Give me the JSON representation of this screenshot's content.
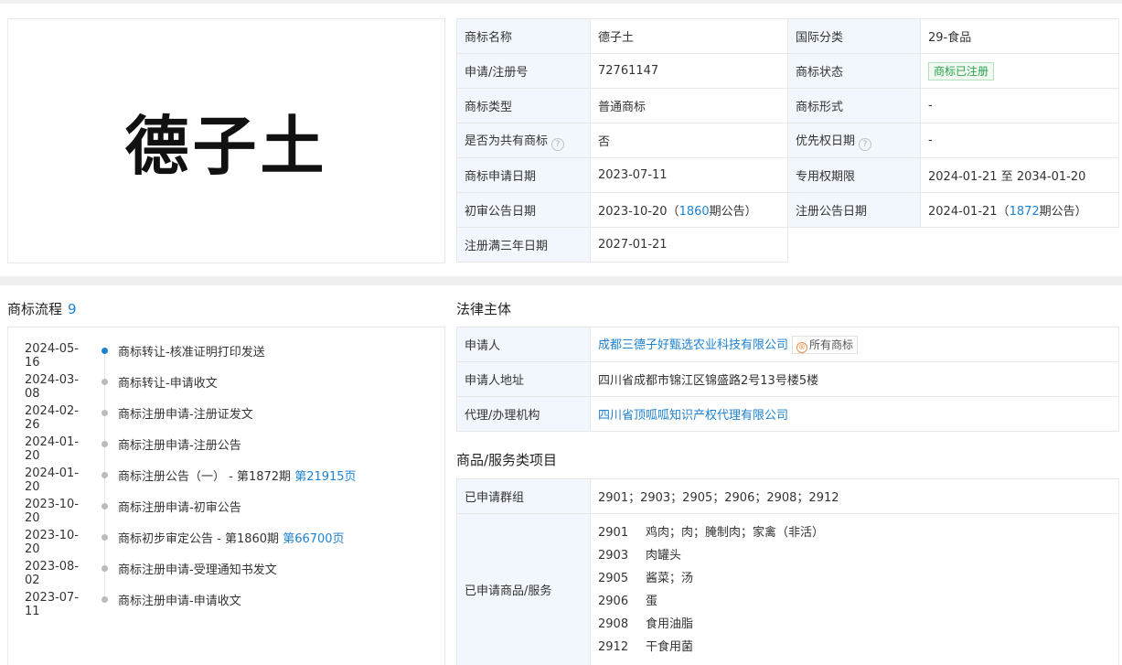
{
  "trademark": {
    "image_text": "德子土",
    "basic": [
      [
        {
          "k": "商标名称",
          "v": "德子土"
        },
        {
          "k": "国际分类",
          "v": "29-食品"
        }
      ],
      [
        {
          "k": "申请/注册号",
          "v": "72761147"
        },
        {
          "k": "商标状态",
          "v": "商标已注册"
        }
      ],
      [
        {
          "k": "商标类型",
          "v": "普通商标"
        },
        {
          "k": "商标形式",
          "v": "-"
        }
      ],
      [
        {
          "k": "是否为共有商标",
          "v": "否"
        },
        {
          "k": "优先权日期",
          "v": "-"
        }
      ],
      [
        {
          "k": "商标申请日期",
          "v": "2023-07-11"
        },
        {
          "k": "专用权期限",
          "v": "2024-01-21 至 2034-01-20"
        }
      ],
      [
        {
          "k": "初审公告日期",
          "v_pre": "2023-10-20（",
          "v_link": "1860",
          "v_post": "期公告）"
        },
        {
          "k": "注册公告日期",
          "v_pre": "2024-01-21（",
          "v_link": "1872",
          "v_post": "期公告）"
        }
      ],
      [
        {
          "k": "注册满三年日期",
          "v": "2027-01-21"
        }
      ]
    ],
    "help_icon": "?"
  },
  "flow": {
    "title": "商标流程",
    "count": "9",
    "items": [
      {
        "date": "2024-05-16",
        "text": "商标转让-核准证明打印发送",
        "active": true
      },
      {
        "date": "2024-03-08",
        "text": "商标转让-申请收文"
      },
      {
        "date": "2024-02-26",
        "text": "商标注册申请-注册证发文"
      },
      {
        "date": "2024-01-20",
        "text": "商标注册申请-注册公告"
      },
      {
        "date": "2024-01-20",
        "text": "商标注册公告（一） - 第1872期 ",
        "link": "第21915页"
      },
      {
        "date": "2023-10-20",
        "text": "商标注册申请-初审公告"
      },
      {
        "date": "2023-10-20",
        "text": "商标初步审定公告 - 第1860期 ",
        "link": "第66700页"
      },
      {
        "date": "2023-08-02",
        "text": "商标注册申请-受理通知书发文"
      },
      {
        "date": "2023-07-11",
        "text": "商标注册申请-申请收文"
      }
    ]
  },
  "legal": {
    "title": "法律主体",
    "applicant_label": "申请人",
    "applicant": "成都三德子好甄选农业科技有限公司",
    "all_tm_icon": "®",
    "all_tm_label": "所有商标",
    "address_label": "申请人地址",
    "address": "四川省成都市锦江区锦盛路2号13号楼5楼",
    "agent_label": "代理/办理机构",
    "agent": "四川省顶呱呱知识产权代理有限公司"
  },
  "goods": {
    "title": "商品/服务类项目",
    "groups_label": "已申请群组",
    "groups": "2901；2903；2905；2906；2908；2912",
    "services_label": "已申请商品/服务",
    "services": [
      {
        "code": "2901",
        "name": "鸡肉；肉；腌制肉；家禽（非活）"
      },
      {
        "code": "2903",
        "name": "肉罐头"
      },
      {
        "code": "2905",
        "name": "酱菜；汤"
      },
      {
        "code": "2906",
        "name": "蛋"
      },
      {
        "code": "2908",
        "name": "食用油脂"
      },
      {
        "code": "2912",
        "name": "干食用菌"
      }
    ]
  },
  "colors": {
    "accent": "#1e82d2",
    "key_bg": "#f1f7fc",
    "status_green": "#2aa24a"
  }
}
